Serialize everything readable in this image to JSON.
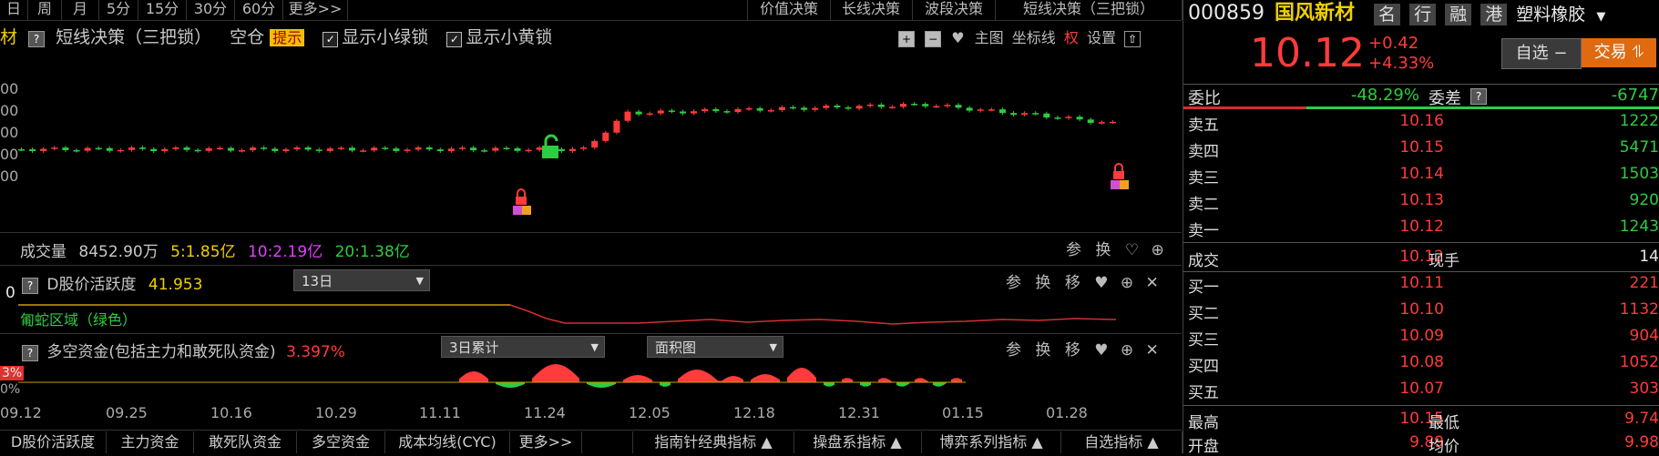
{
  "period_tabs": [
    "日",
    "周",
    "月",
    "5分",
    "15分",
    "30分",
    "60分",
    "更多>>"
  ],
  "strategy_tabs": [
    "价值决策",
    "长线决策",
    "波段决策",
    "短线决策（三把锁）"
  ],
  "chart_header": {
    "partial_name": "材",
    "help": "?",
    "indicator": "短线决策（三把锁）",
    "empty_pos": "空仓",
    "hint": "提示",
    "cb1": "显示小绿锁",
    "cb2": "显示小黄锁",
    "main_chart": "主图",
    "axis": "坐标线",
    "quan": "权",
    "settings": "设置"
  },
  "price_axis": [
    "00",
    "00",
    "00",
    "00",
    "00"
  ],
  "volume": {
    "label": "成交量",
    "value": "8452.90万",
    "ma5": "5:1.85亿",
    "ma10": "10:2.19亿",
    "ma20": "20:1.38亿",
    "ref": "参",
    "swap": "换"
  },
  "d_panel": {
    "help": "?",
    "title": "D股价活跃度",
    "value": "41.953",
    "period": "13日",
    "zero": "0",
    "zone": "匍蛇区域（绿色）",
    "ref": "参",
    "swap": "换",
    "move": "移"
  },
  "dk_panel": {
    "help": "?",
    "title": "多空资金(包括主力和敢死队资金)",
    "value": "3.397%",
    "period": "3日累计",
    "type": "面积图",
    "y_top": "3%",
    "y_zero": "0%",
    "ref": "参",
    "swap": "换",
    "move": "移"
  },
  "date_axis": [
    "09.12",
    "09.25",
    "10.16",
    "10.29",
    "11.11",
    "11.24",
    "12.05",
    "12.18",
    "12.31",
    "01.15",
    "01.28"
  ],
  "bottom_tabs": [
    "D股价活跃度",
    "主力资金",
    "敢死队资金",
    "多空资金",
    "成本均线(CYC)",
    "更多>>",
    "指南针经典指标 ▲",
    "操盘系指标 ▲",
    "博弈系列指标 ▲",
    "自选指标 ▲"
  ],
  "stock": {
    "code": "000859",
    "name": "国风新材",
    "tags": [
      "名",
      "行",
      "融",
      "港"
    ],
    "sector": "塑料橡胶",
    "price": "10.12",
    "change": "+0.42",
    "pct": "+4.33%",
    "watch_btn": "自选 −",
    "trade_btn": "交易 ⥮"
  },
  "ratio": {
    "label": "委比",
    "value": "-48.29%",
    "diff_label": "委差",
    "diff_value": "-6747"
  },
  "asks": [
    {
      "label": "卖五",
      "price": "10.16",
      "vol": "1222"
    },
    {
      "label": "卖四",
      "price": "10.15",
      "vol": "5471"
    },
    {
      "label": "卖三",
      "price": "10.14",
      "vol": "1503"
    },
    {
      "label": "卖二",
      "price": "10.13",
      "vol": "920"
    },
    {
      "label": "卖一",
      "price": "10.12",
      "vol": "1243"
    }
  ],
  "trade": {
    "label": "成交",
    "price": "10.12",
    "hand_label": "现手",
    "hand": "14"
  },
  "bids": [
    {
      "label": "买一",
      "price": "10.11",
      "vol": "221"
    },
    {
      "label": "买二",
      "price": "10.10",
      "vol": "1132"
    },
    {
      "label": "买三",
      "price": "10.09",
      "vol": "904"
    },
    {
      "label": "买四",
      "price": "10.08",
      "vol": "1052"
    },
    {
      "label": "买五",
      "price": "10.07",
      "vol": "303"
    }
  ],
  "stats": {
    "high_label": "最高",
    "high": "10.15",
    "low_label": "最低",
    "low": "9.74",
    "open_label": "开盘",
    "open": "9.89",
    "avg_label": "均价",
    "avg": "9.98"
  },
  "colors": {
    "up": "#ff3b3b",
    "down": "#2ecc40",
    "accent": "#f0a020",
    "bg": "#000000"
  }
}
